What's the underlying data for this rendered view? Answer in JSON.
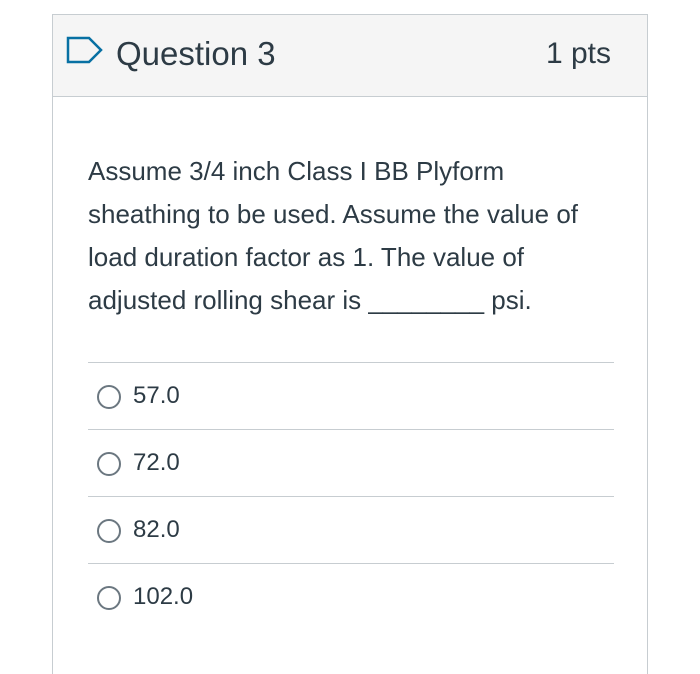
{
  "question": {
    "title": "Question 3",
    "points": "1 pts",
    "flag_icon": "flag-outline-icon",
    "text": "Assume 3/4 inch Class I BB Plyform sheathing to be used. Assume the value of load duration factor as 1. The value of adjusted rolling shear is ________ psi."
  },
  "answers": [
    {
      "label": "57.0"
    },
    {
      "label": "72.0"
    },
    {
      "label": "82.0"
    },
    {
      "label": "102.0"
    }
  ],
  "colors": {
    "accent": "#0770a3",
    "text": "#2d3b45",
    "border": "#c7cdd1",
    "header_bg": "#f5f5f5"
  }
}
